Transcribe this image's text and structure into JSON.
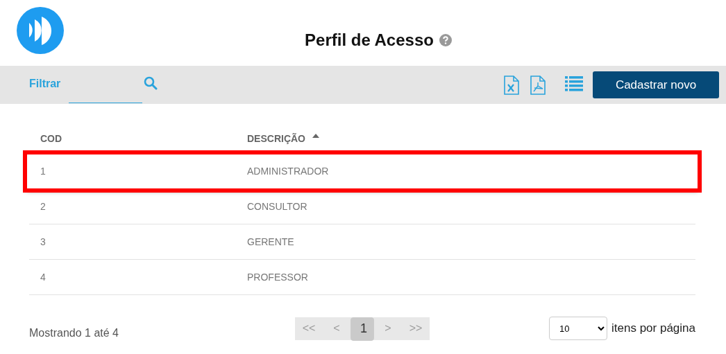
{
  "header": {
    "title": "Perfil de Acesso"
  },
  "toolbar": {
    "filter_label": "Filtrar",
    "export_buttons": [
      {
        "kind": "excel"
      },
      {
        "kind": "pdf"
      }
    ],
    "primary_button": "Cadastrar novo"
  },
  "table": {
    "columns": [
      {
        "label": "COD",
        "sorted": false
      },
      {
        "label": "DESCRIÇÃO",
        "sorted": true
      }
    ],
    "rows": [
      {
        "cells": [
          "1",
          "ADMINISTRADOR"
        ],
        "highlighted": true
      },
      {
        "cells": [
          "2",
          "CONSULTOR"
        ],
        "highlighted": false
      },
      {
        "cells": [
          "3",
          "GERENTE"
        ],
        "highlighted": false
      },
      {
        "cells": [
          "4",
          "PROFESSOR"
        ],
        "highlighted": false
      }
    ]
  },
  "footer": {
    "summary": "Mostrando 1 até 4",
    "pagination": [
      {
        "label": "<<",
        "selected": false
      },
      {
        "label": "<",
        "selected": false
      },
      {
        "label": "1",
        "selected": true
      },
      {
        "label": ">",
        "selected": false
      },
      {
        "label": ">>",
        "selected": false
      }
    ],
    "page_size": "10",
    "page_size_label": "itens por página"
  }
}
